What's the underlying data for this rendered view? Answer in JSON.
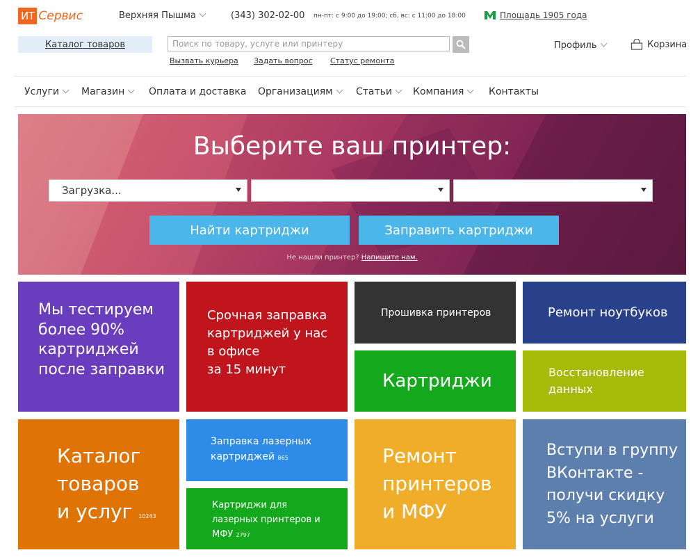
{
  "header": {
    "logo_box": "ИТ",
    "logo_text": "Сервис",
    "city": "Верхняя Пышма",
    "phone": "(343) 302-02-00",
    "hours": "пн-пт: с 9:00 до 19:00; сб, вс: с 11:00 до 18:00",
    "metro": "Площадь 1905 года",
    "catalog": "Каталог товаров",
    "search_placeholder": "Поиск по товару, услуге или принтеру",
    "sublinks": [
      "Вызвать курьера",
      "Задать вопрос",
      "Статус ремонта"
    ],
    "profile": "Профиль",
    "cart": "Корзина"
  },
  "nav": [
    "Услуги",
    "Магазин",
    "Оплата и доставка",
    "Организациям",
    "Статьи",
    "Компания",
    "Контакты"
  ],
  "hero": {
    "title": "Выберите ваш принтер:",
    "select1": "Загрузка...",
    "select2": "",
    "select3": "",
    "btn_find": "Найти картриджи",
    "btn_refill": "Заправить картриджи",
    "note_text": "Не нашли принтер?",
    "note_link": "Напишите нам."
  },
  "tiles": {
    "test_l1": "Мы тестируем",
    "test_l2": "более 90%",
    "test_l3": "картриджей",
    "test_l4": "после заправки",
    "urgent_l1": "Срочная заправка",
    "urgent_l2": "картриджей у нас",
    "urgent_l3": "в офисе",
    "urgent_l4": "за 15 минут",
    "firmware": "Прошивка принтеров",
    "cartridges": "Картриджи",
    "laptop": "Ремонт ноутбуков",
    "data_l1": "Восстановление",
    "data_l2": "данных",
    "catalog_l1": "Каталог",
    "catalog_l2": "товаров",
    "catalog_l3": "и услуг",
    "catalog_count": "10243",
    "laser_refill_l1": "Заправка лазерных",
    "laser_refill_l2": "картриджей",
    "laser_refill_count": "865",
    "laser_cart_l1": "Картриджи для",
    "laser_cart_l2": "лазерных принтеров и",
    "laser_cart_l3": "МФУ",
    "laser_cart_count": "2797",
    "repair_l1": "Ремонт",
    "repair_l2": "принтеров",
    "repair_l3": "и МФУ",
    "vk_l1": "Вступи в группу",
    "vk_l2": "ВКонтакте -",
    "vk_l3": "получи скидку",
    "vk_l4": "5% на услуги"
  },
  "colors": {
    "brand": "#f0661e",
    "purple": "#6a3dbf",
    "red": "#c0151c",
    "dark": "#333333",
    "green": "#14a81c",
    "navy": "#29418a",
    "olive": "#a6ba0a",
    "orange": "#e07305",
    "blue": "#2e8ce8",
    "yellow": "#f0ad2a",
    "steel": "#5d7fae",
    "button": "#4ab6ea"
  }
}
